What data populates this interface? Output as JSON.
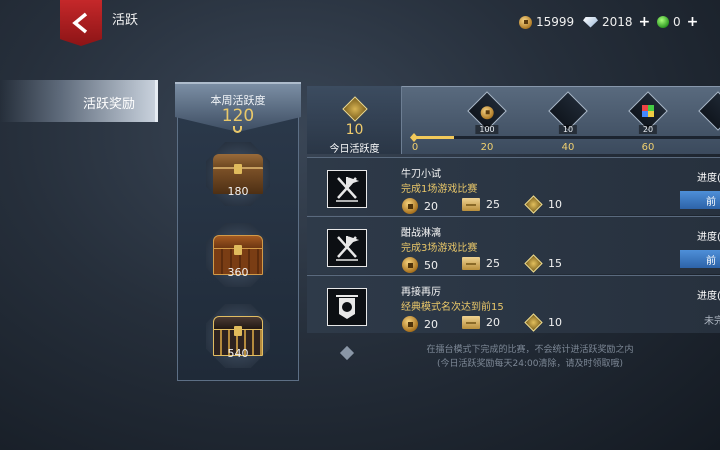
{
  "header": {
    "title": "活跃",
    "currencies": [
      {
        "icon": "gold-coin-icon",
        "value": "15999"
      },
      {
        "icon": "diamond-icon",
        "value": "2018"
      },
      {
        "icon": "green-gem-icon",
        "value": "0"
      }
    ]
  },
  "nav": {
    "items": [
      {
        "label": "活跃奖励",
        "active": true
      }
    ]
  },
  "week": {
    "label": "本周活跃度",
    "value": "120",
    "chests": [
      {
        "icon": "wooden-chest-icon",
        "value": "180"
      },
      {
        "icon": "bronze-chest-icon",
        "value": "360"
      },
      {
        "icon": "gold-chest-icon",
        "value": "540"
      }
    ]
  },
  "today": {
    "value": "10",
    "label": "今日活跃度",
    "progress_value": 10,
    "track_max": 75,
    "ticks": [
      "0",
      "20",
      "40",
      "60"
    ],
    "milestones": [
      {
        "icon": "gold-coin-icon",
        "count": "100"
      },
      {
        "icon": "diamond-icon",
        "count": "10"
      },
      {
        "icon": "multicolor-gem-icon",
        "count": "20"
      }
    ]
  },
  "tasks": [
    {
      "icon": "crossed-swords-flag-icon",
      "title": "牛刀小试",
      "desc": "完成1场游戏比赛",
      "coins": "20",
      "tickets": "25",
      "points": "10",
      "progress_label": "进度(",
      "button": "前"
    },
    {
      "icon": "crossed-swords-flag-icon",
      "title": "酣战淋漓",
      "desc": "完成3场游戏比赛",
      "coins": "50",
      "tickets": "25",
      "points": "15",
      "progress_label": "进度(",
      "button": "前"
    },
    {
      "icon": "banner-emblem-icon",
      "title": "再接再厉",
      "desc": "经典模式名次达到前15",
      "coins": "20",
      "tickets": "20",
      "points": "10",
      "progress_label": "进度(",
      "status": "未完"
    }
  ],
  "footer": {
    "line1": "在擂台模式下完成的比赛，不会统计进活跃奖励之内",
    "line2": "(今日活跃奖励每天24:00清除，请及时领取哦)"
  },
  "colors": {
    "accent_gold": "#e9c869",
    "button_blue": "#3a78c2",
    "back_red": "#b8201f"
  }
}
